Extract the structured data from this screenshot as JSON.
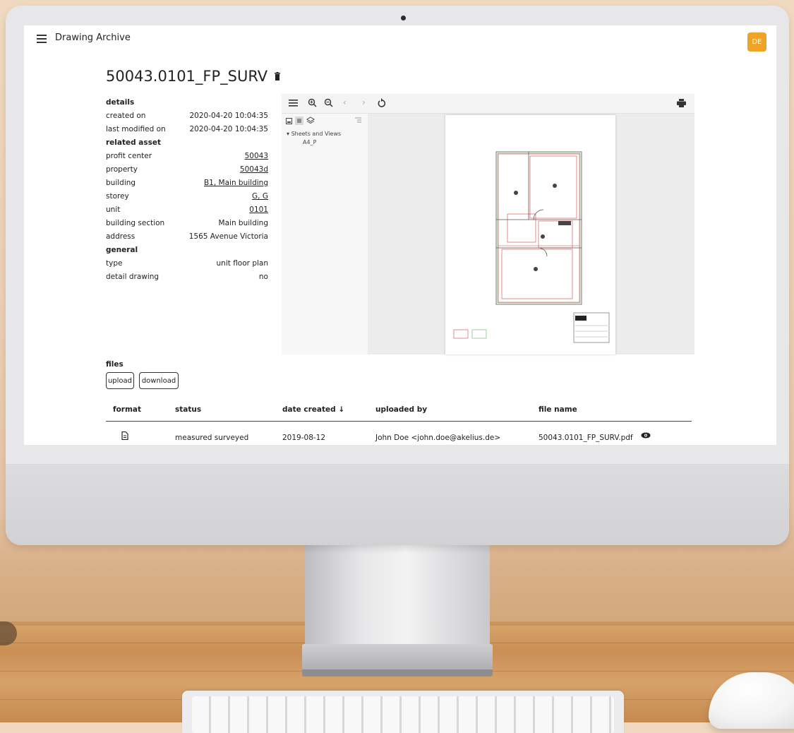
{
  "app": {
    "title": "Drawing Archive",
    "user_initials": "DE"
  },
  "document": {
    "title": "50043.0101_FP_SURV"
  },
  "details": {
    "section_details": "details",
    "created_on_label": "created on",
    "created_on": "2020-04-20 10:04:35",
    "modified_label": "last modified on",
    "modified": "2020-04-20 10:04:35",
    "section_related": "related asset",
    "profit_center_label": "profit center",
    "profit_center": "50043",
    "property_label": "property",
    "property": "50043d",
    "building_label": "building",
    "building": "B1, Main building",
    "storey_label": "storey",
    "storey": "G, G",
    "unit_label": "unit",
    "unit": "0101",
    "section_label": "building section",
    "section": "Main building",
    "address_label": "address",
    "address": "1565 Avenue Victoria",
    "section_general": "general",
    "type_label": "type",
    "type": "unit floor plan",
    "detail_label": "detail drawing",
    "detail": "no"
  },
  "viewer": {
    "tree_root": "Sheets and Views",
    "tree_child": "A4_P",
    "tool_icons": [
      "menu-icon",
      "zoom-in-icon",
      "zoom-out-icon",
      "previous-icon",
      "next-icon",
      "rotate-icon",
      "print-icon"
    ]
  },
  "files": {
    "label": "files",
    "upload_label": "upload",
    "download_label": "download",
    "columns": {
      "format": "format",
      "status": "status",
      "date": "date created ↓",
      "uploaded_by": "uploaded by",
      "file_name": "file name"
    },
    "rows": [
      {
        "format_icon": "document-icon",
        "status": "measured surveyed",
        "date": "2019-08-12",
        "uploaded_by": "John Doe <john.doe@akelius.de>",
        "file_name": "50043.0101_FP_SURV.pdf"
      }
    ]
  },
  "colors": {
    "avatar": "#f0a427",
    "accent_dark": "#222222",
    "plan_lines": "#d04040",
    "plan_green": "#6aa86a"
  }
}
